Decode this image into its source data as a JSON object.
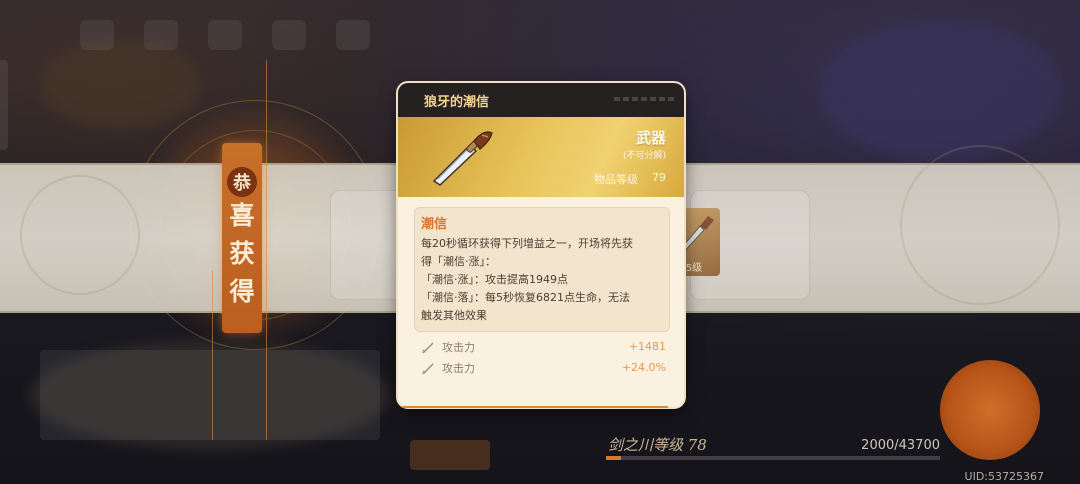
{
  "background": {
    "congrats_chars": [
      "恭",
      "喜",
      "获",
      "得"
    ],
    "ghost_item_level_suffix": "5级"
  },
  "tooltip": {
    "item_name": "狼牙的潮信",
    "category": "武器",
    "note": "(不可分解)",
    "item_level_label": "物品等级",
    "item_level_value": "79",
    "icon": "dagger-icon",
    "effect": {
      "title": "潮信",
      "lines": [
        "每20秒循环获得下列增益之一，开场将先获",
        "得「潮信·涨」：",
        "「潮信·涨」：攻击提高1949点",
        "「潮信·落」：每5秒恢复6821点生命，无法",
        "触发其他效果"
      ]
    },
    "stats": [
      {
        "name": "攻击力",
        "value": "+1481",
        "icon": "sword-icon"
      },
      {
        "name": "攻击力",
        "value": "+24.0%",
        "icon": "sword-icon"
      }
    ]
  },
  "footer": {
    "level_label": "剑之川等级 78",
    "exp_text": "2000/43700",
    "exp_progress": 0.0458,
    "uid": "UID:53725367"
  },
  "colors": {
    "accent_orange": "#d67a2a",
    "header_gold": "#f3d38f",
    "effect_title": "#d9762c",
    "stat_value": "#e09b57"
  }
}
